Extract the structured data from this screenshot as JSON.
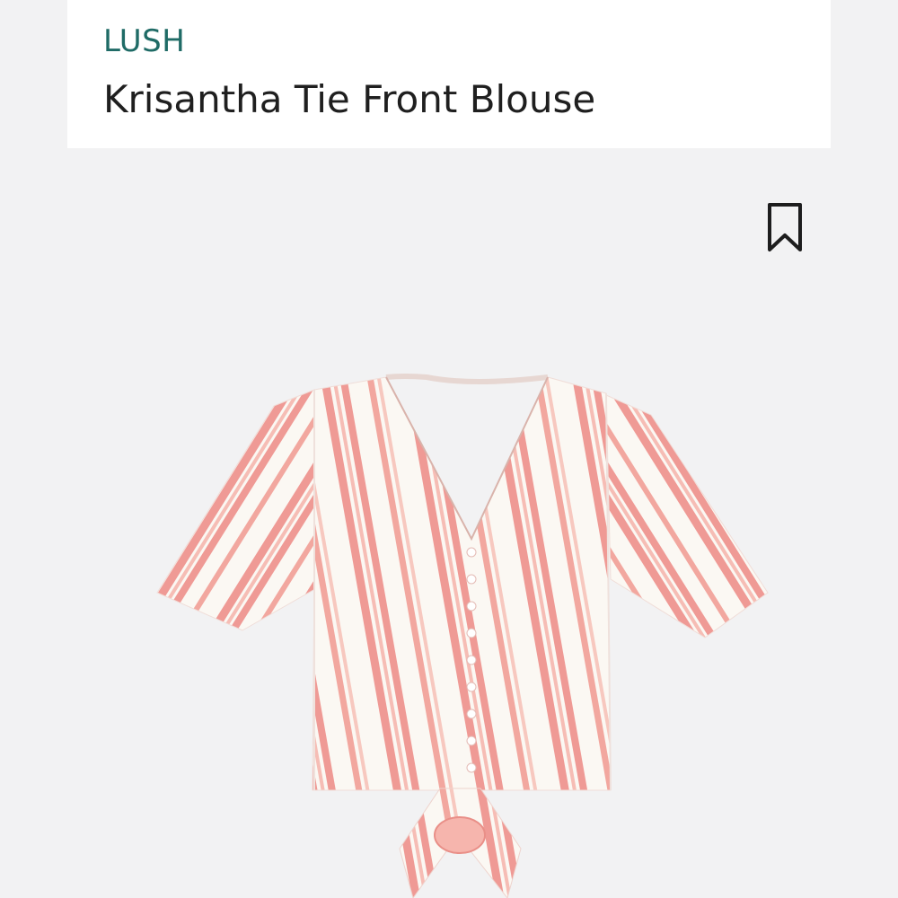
{
  "product": {
    "brand": "LUSH",
    "name": "Krisantha Tie Front Blouse"
  },
  "icons": {
    "save": "bookmark-icon"
  },
  "colors": {
    "brand": "#1f6b66",
    "title": "#1f1f1f",
    "background": "#f2f2f3",
    "stripe_pink": "#ef9a95",
    "fabric": "#fbf8f3"
  }
}
